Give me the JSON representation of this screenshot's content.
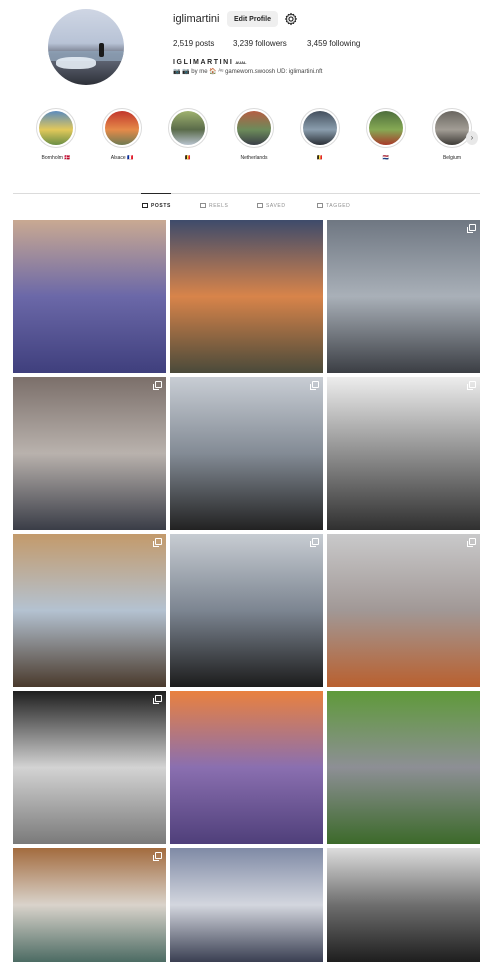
{
  "profile": {
    "username": "iglimartini",
    "edit_profile_label": "Edit Profile",
    "posts": "2,519 posts",
    "followers": "3,239 followers",
    "following": "3,459 following",
    "bio_name": "IGLIMARTINI",
    "bio_name_tag": "AUAL",
    "bio_line": "📷 📷 by me 🏠 ᴬᵘ gameworn.swoosh UD: iglimartini.nft"
  },
  "highlights": [
    {
      "label": "Bornholm 🇩🇰",
      "colors": [
        "#5b8bbd",
        "#e2c85a",
        "#6a8e45"
      ]
    },
    {
      "label": "Alsace 🇫🇷",
      "colors": [
        "#c2362c",
        "#e58a49",
        "#6f7b52"
      ]
    },
    {
      "label": "🇧🇪",
      "colors": [
        "#9fb26f",
        "#5a6b4a",
        "#b7c2cd"
      ]
    },
    {
      "label": "Netherlands",
      "colors": [
        "#b55e43",
        "#6c8b5a",
        "#3a3f47"
      ]
    },
    {
      "label": "🇧🇪",
      "colors": [
        "#44505e",
        "#8a9dad",
        "#2a2f36"
      ]
    },
    {
      "label": "🇳🇱",
      "colors": [
        "#4e6e3c",
        "#86a954",
        "#a83a2a"
      ]
    },
    {
      "label": "Belgium",
      "colors": [
        "#6a6660",
        "#a29d95",
        "#3e3b37"
      ]
    }
  ],
  "tabs": [
    {
      "label": "POSTS",
      "active": true
    },
    {
      "label": "REELS",
      "active": false
    },
    {
      "label": "SAVED",
      "active": false
    },
    {
      "label": "TAGGED",
      "active": false
    }
  ],
  "posts": [
    {
      "subject": "purple city skyline aerial",
      "multi": false,
      "palette": [
        "#c9a992",
        "#6b68a8",
        "#3f3f7d"
      ]
    },
    {
      "subject": "sunset skyscrapers",
      "multi": false,
      "palette": [
        "#3e4b6b",
        "#d8844a",
        "#4a4a3a"
      ]
    },
    {
      "subject": "storefront with shutters and bags",
      "multi": true,
      "palette": [
        "#6f7782",
        "#a9b0b8",
        "#3b3e44"
      ]
    },
    {
      "subject": "street scooter rider",
      "multi": true,
      "palette": [
        "#7b6f6a",
        "#b9b2ad",
        "#3a3d47"
      ]
    },
    {
      "subject": "harbor skyline",
      "multi": true,
      "palette": [
        "#c8cdd4",
        "#838b95",
        "#222222"
      ]
    },
    {
      "subject": "spiral staircase black and white",
      "multi": true,
      "palette": [
        "#ededed",
        "#8f8f8f",
        "#303030"
      ]
    },
    {
      "subject": "looking up between buildings",
      "multi": true,
      "palette": [
        "#c39a6b",
        "#b4c2d1",
        "#4a3a2c"
      ]
    },
    {
      "subject": "harbor skyline through window",
      "multi": true,
      "palette": [
        "#c7ccd2",
        "#7c8591",
        "#1c1c1c"
      ]
    },
    {
      "subject": "great wall in autumn fog",
      "multi": true,
      "palette": [
        "#c9c9ca",
        "#a19896",
        "#b9602f"
      ]
    },
    {
      "subject": "arched window tunnel",
      "multi": true,
      "palette": [
        "#1f1f1f",
        "#d3d3d3",
        "#7a7a7a"
      ]
    },
    {
      "subject": "lavender field sunset",
      "multi": false,
      "palette": [
        "#e9813f",
        "#8a6fb0",
        "#4f3f7a"
      ]
    },
    {
      "subject": "stone head sculpture in hedges",
      "multi": false,
      "palette": [
        "#5f9a3a",
        "#8d8f95",
        "#3c6a2a"
      ]
    },
    {
      "subject": "ornate arched doors",
      "multi": true,
      "palette": [
        "#a36b3e",
        "#d9d3cb",
        "#4c6b63"
      ]
    },
    {
      "subject": "coastal town at dusk",
      "multi": false,
      "palette": [
        "#7f8aa5",
        "#d3d6de",
        "#3a3f52"
      ]
    },
    {
      "subject": "glass ceiling corridor",
      "multi": false,
      "palette": [
        "#dddddd",
        "#6e6e6e",
        "#1e1e1e"
      ]
    }
  ]
}
